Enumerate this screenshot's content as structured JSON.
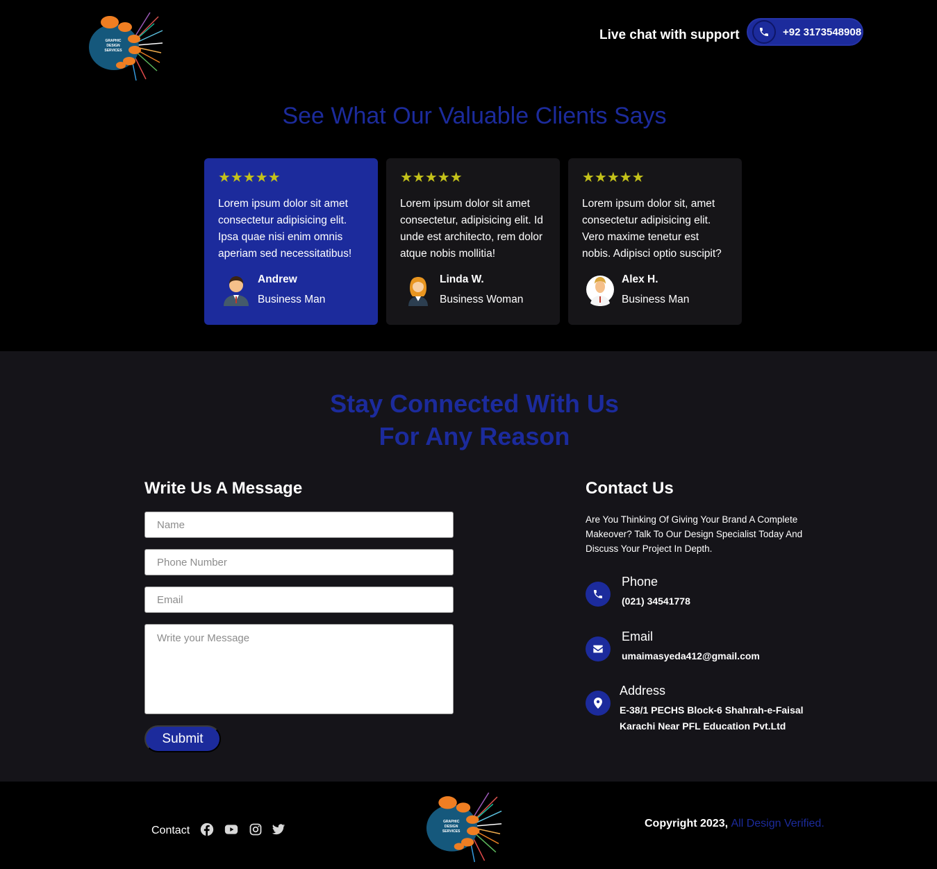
{
  "header": {
    "live_chat": "Live chat with support",
    "phone": "+92 3173548908"
  },
  "testimonials": {
    "title": "See What Our Valuable Clients Says",
    "stars": "★★★★★",
    "items": [
      {
        "text": "Lorem ipsum dolor sit amet consectetur adipisicing elit. Ipsa quae nisi enim omnis aperiam sed necessitatibus!",
        "name": "Andrew",
        "role": "Business Man"
      },
      {
        "text": "Lorem ipsum dolor sit amet consectetur, adipisicing elit. Id unde est architecto, rem dolor atque nobis mollitia!",
        "name": "Linda W.",
        "role": "Business Woman"
      },
      {
        "text": "Lorem ipsum dolor sit, amet consectetur adipisicing elit. Vero maxime tenetur est nobis. Adipisci optio suscipit?",
        "name": "Alex H.",
        "role": "Business Man"
      }
    ]
  },
  "contact": {
    "title_line1": "Stay Connected With Us",
    "title_line2": "For Any Reason",
    "form": {
      "title": "Write Us A Message",
      "name_placeholder": "Name",
      "phone_placeholder": "Phone Number",
      "email_placeholder": "Email",
      "message_placeholder": "Write your Message",
      "submit": "Submit"
    },
    "info": {
      "title": "Contact Us",
      "description": "Are You Thinking Of Giving Your Brand A Complete Makeover? Talk To Our Design Specialist Today And Discuss Your Project In Depth.",
      "phone_label": "Phone",
      "phone_value": "(021) 34541778",
      "email_label": "Email",
      "email_value": "umaimasyeda412@gmail.com",
      "address_label": "Address",
      "address_line1": "E-38/1 PECHS Block-6 Shahrah-e-Faisal",
      "address_line2": "Karachi Near PFL Education Pvt.Ltd"
    }
  },
  "footer": {
    "contact": "Contact",
    "copyright": "Copyright 2023,",
    "copyright_link": "All Design Verified."
  },
  "logo": {
    "line1": "GRAPHIC",
    "line2": "DESIGN",
    "line3": "SERVICES"
  },
  "colors": {
    "accent": "#1c2b9c",
    "stars": "#c4c21a",
    "card": "#161518",
    "section_bg": "#151419",
    "logo_orange": "#ef7e22",
    "logo_blue": "#15587c"
  },
  "icons": {
    "phone": "phone-icon",
    "email": "envelope-icon",
    "address": "map-marker-icon",
    "social": [
      "facebook-icon",
      "youtube-icon",
      "instagram-icon",
      "twitter-icon"
    ]
  }
}
